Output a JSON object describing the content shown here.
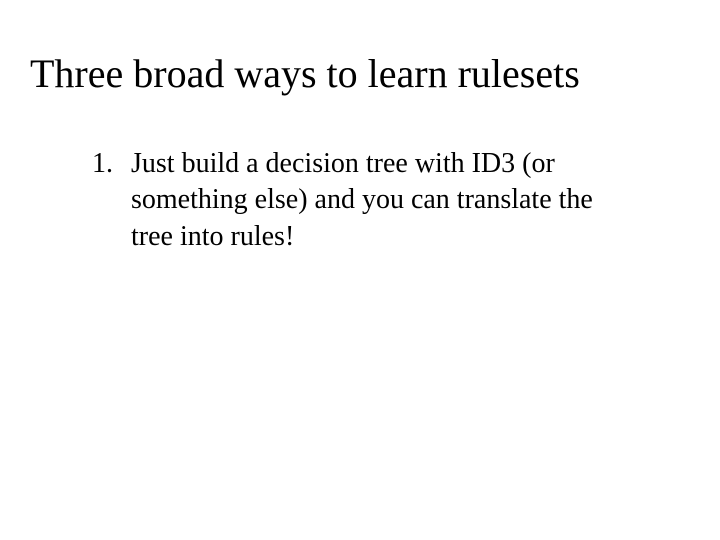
{
  "title": "Three broad ways to learn rulesets",
  "items": [
    {
      "marker": "1.",
      "text": "Just build a decision tree with ID3 (or something else) and you can translate the tree into rules!"
    }
  ]
}
